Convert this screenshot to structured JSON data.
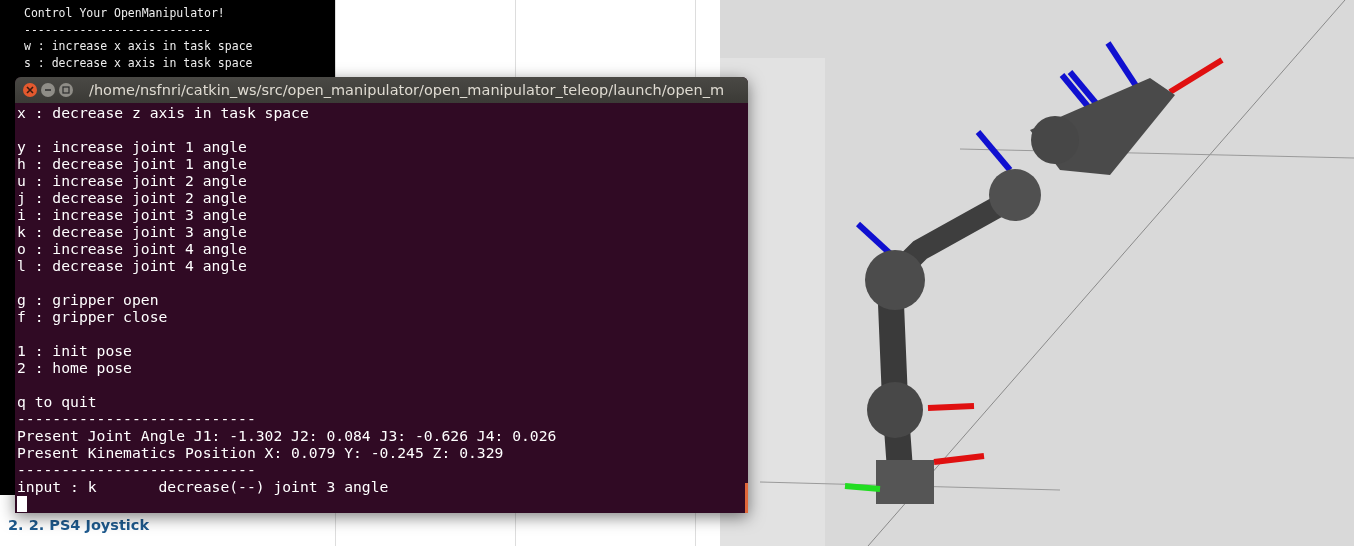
{
  "background_terminal": {
    "lines": [
      "Control Your OpenManipulator!",
      "---------------------------",
      "w : increase x axis in task space",
      "s : decrease x axis in task space"
    ]
  },
  "terminal": {
    "title": "/home/nsfnri/catkin_ws/src/open_manipulator/open_manipulator_teleop/launch/open_m",
    "sections": [
      [
        "x : decrease z axis in task space"
      ],
      [
        "y : increase joint 1 angle",
        "h : decrease joint 1 angle",
        "u : increase joint 2 angle",
        "j : decrease joint 2 angle",
        "i : increase joint 3 angle",
        "k : decrease joint 3 angle",
        "o : increase joint 4 angle",
        "l : decrease joint 4 angle"
      ],
      [
        "g : gripper open",
        "f : gripper close"
      ],
      [
        "1 : init pose",
        "2 : home pose"
      ],
      [
        "q to quit",
        "---------------------------",
        "Present Joint Angle J1: -1.302 J2: 0.084 J3: -0.626 J4: 0.026",
        "Present Kinematics Position X: 0.079 Y: -0.245 Z: 0.329",
        "---------------------------",
        "input : k       decrease(--) joint 3 angle"
      ]
    ]
  },
  "page_heading": "2. 2. PS4 Joystick"
}
